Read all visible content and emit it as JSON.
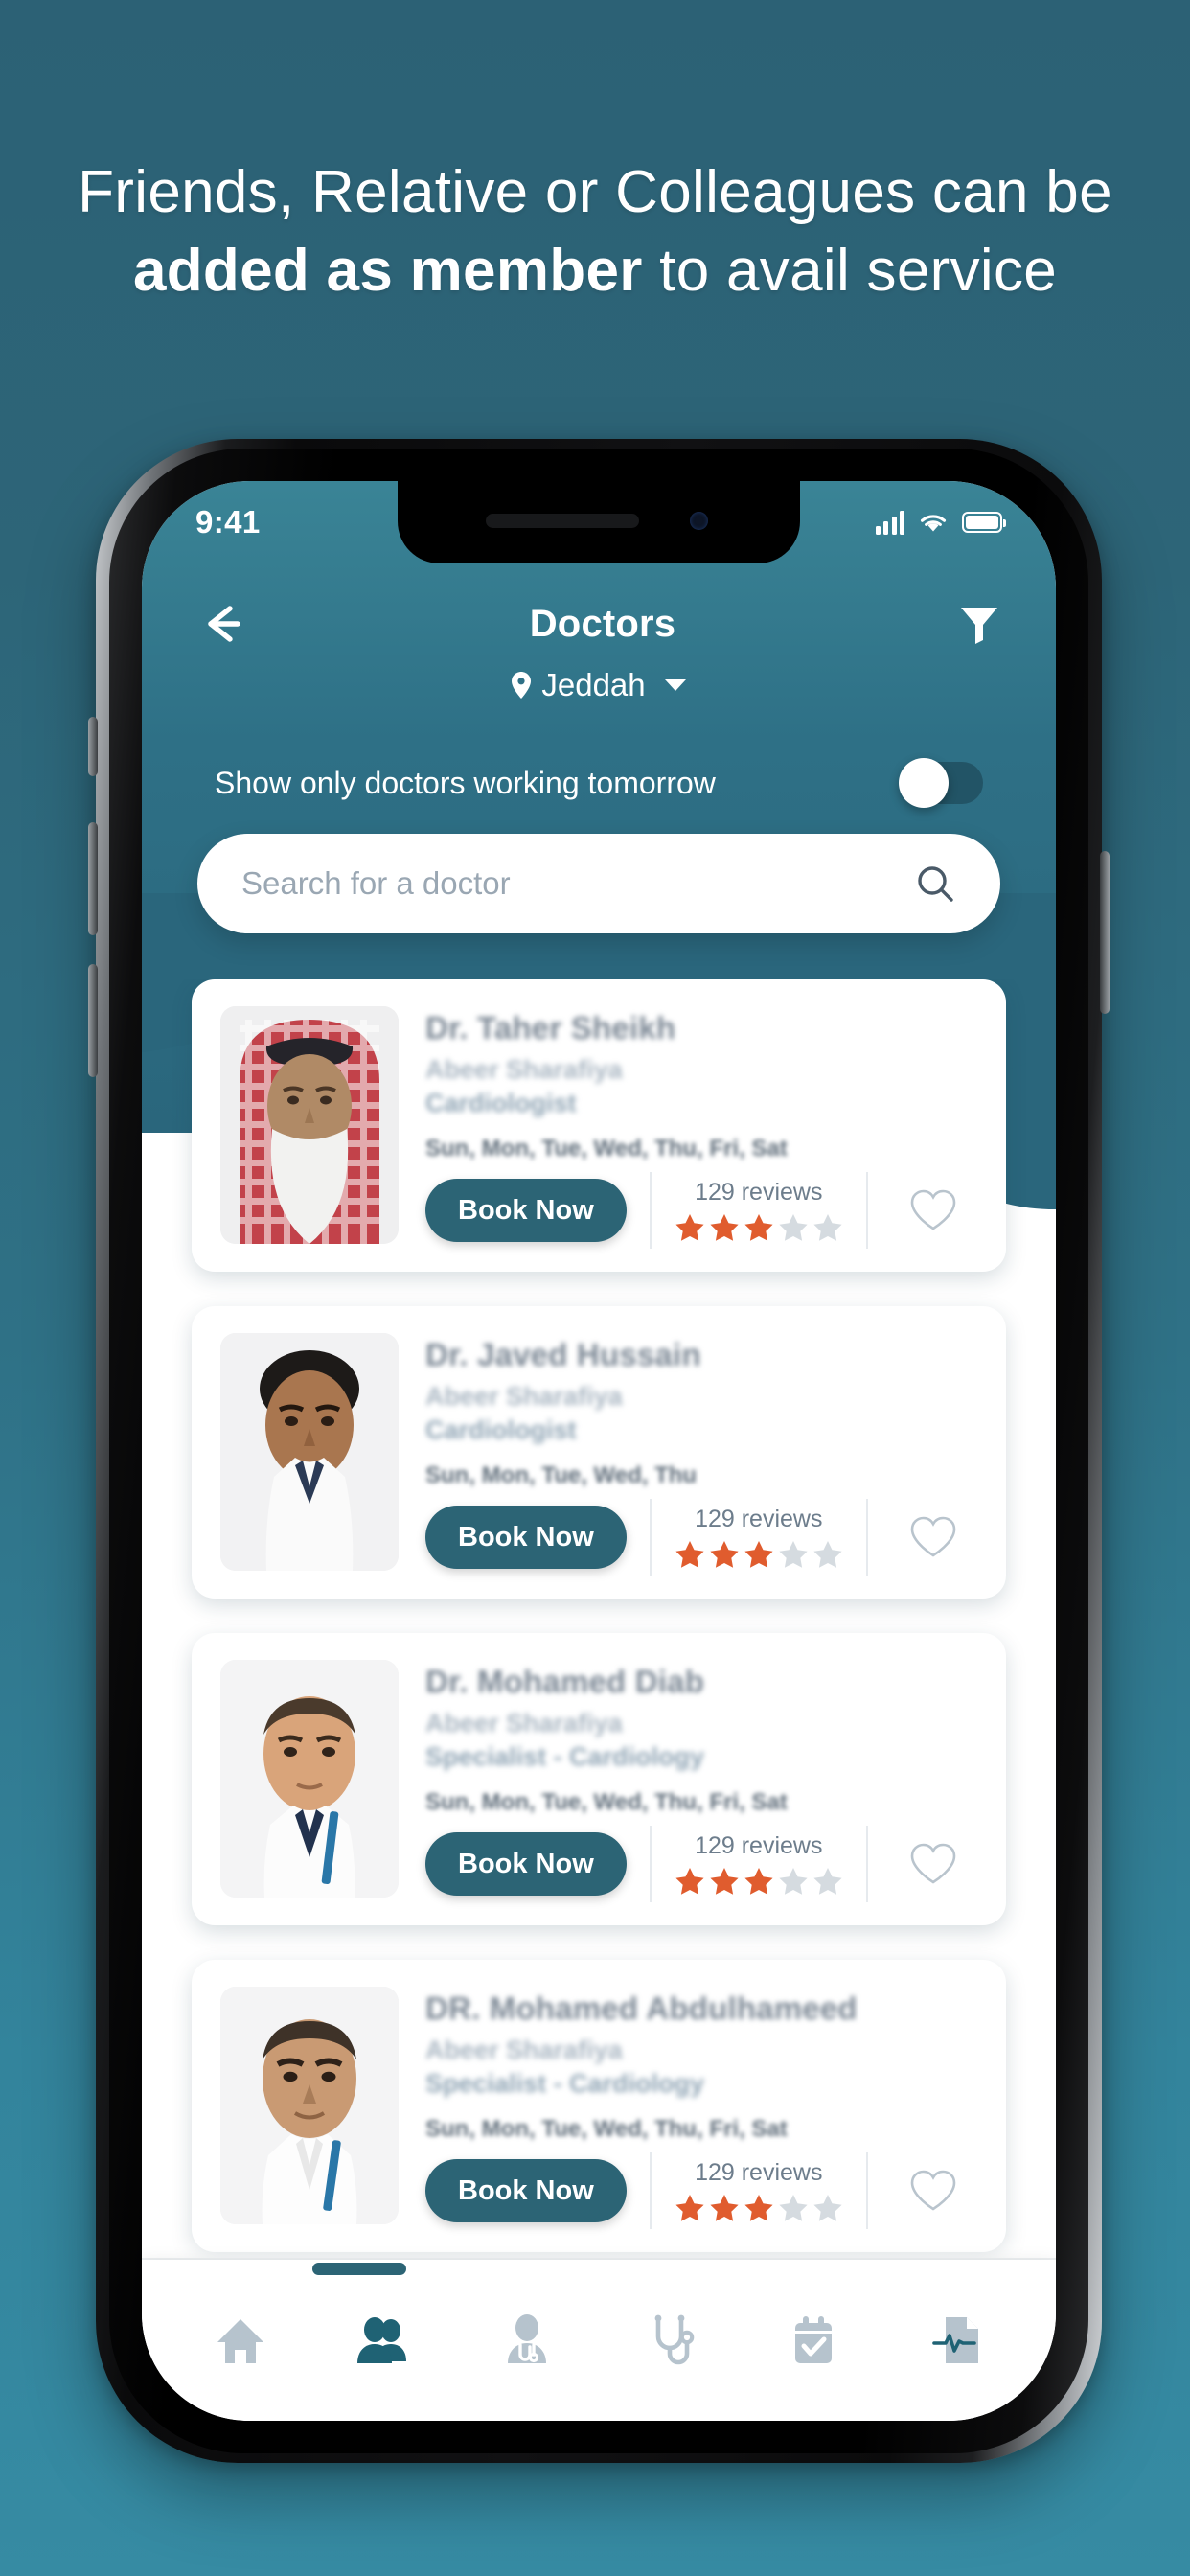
{
  "promo": {
    "line1": "Friends, Relative or Colleagues can be",
    "line2_bold": "added as member",
    "line2_rest": " to avail service"
  },
  "status_bar": {
    "time": "9:41",
    "signal_icon": "signal-bars-icon",
    "wifi_icon": "wifi-icon",
    "battery_icon": "battery-full-icon"
  },
  "header": {
    "back_icon": "back-arrow-icon",
    "title": "Doctors",
    "filter_icon": "filter-icon",
    "location_pin_icon": "location-pin-icon",
    "location": "Jeddah",
    "location_caret_icon": "chevron-down-icon"
  },
  "toggle": {
    "label": "Show only doctors working tomorrow",
    "state": "off"
  },
  "search": {
    "placeholder": "Search for a doctor",
    "value": "",
    "icon": "search-icon"
  },
  "doctors": [
    {
      "name": "Dr. Taher Sheikh",
      "clinic": "Abeer Sharafiya",
      "specialty": "Cardiologist",
      "days": "Sun, Mon, Tue, Wed, Thu, Fri, Sat",
      "book_label": "Book Now",
      "reviews": "129 reviews",
      "rating": 3,
      "max_rating": 5,
      "favorite_icon": "heart-outline-icon"
    },
    {
      "name": "Dr. Javed Hussain",
      "clinic": "Abeer Sharafiya",
      "specialty": "Cardiologist",
      "days": "Sun, Mon, Tue, Wed, Thu",
      "book_label": "Book Now",
      "reviews": "129 reviews",
      "rating": 3,
      "max_rating": 5,
      "favorite_icon": "heart-outline-icon"
    },
    {
      "name": "Dr. Mohamed Diab",
      "clinic": "Abeer Sharafiya",
      "specialty": "Specialist - Cardiology",
      "days": "Sun, Mon, Tue, Wed, Thu, Fri, Sat",
      "book_label": "Book Now",
      "reviews": "129 reviews",
      "rating": 3,
      "max_rating": 5,
      "favorite_icon": "heart-outline-icon"
    },
    {
      "name": "DR. Mohamed Abdulhameed",
      "clinic": "Abeer Sharafiya",
      "specialty": "Specialist - Cardiology",
      "days": "Sun, Mon, Tue, Wed, Thu, Fri, Sat",
      "book_label": "Book Now",
      "reviews": "129 reviews",
      "rating": 3,
      "max_rating": 5,
      "favorite_icon": "heart-outline-icon"
    }
  ],
  "bottom_nav": [
    {
      "icon": "home-icon",
      "active": false
    },
    {
      "icon": "people-group-icon",
      "active": true
    },
    {
      "icon": "doctor-person-icon",
      "active": false
    },
    {
      "icon": "stethoscope-icon",
      "active": false
    },
    {
      "icon": "calendar-check-icon",
      "active": false
    },
    {
      "icon": "medical-report-icon",
      "active": false
    }
  ],
  "colors": {
    "background_top": "#2c6175",
    "background_bottom": "#368ba3",
    "header_teal": "#2e7086",
    "accent_button": "#2c6475",
    "star_filled": "#e05c2e",
    "star_empty": "#d5dbe0",
    "nav_active": "#1f6274",
    "nav_inactive": "#b6c3cd"
  }
}
